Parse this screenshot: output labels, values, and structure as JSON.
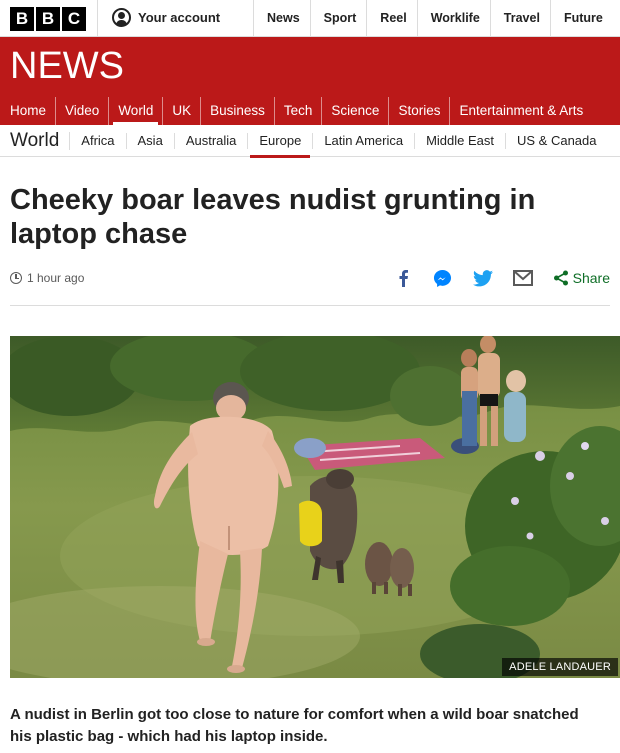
{
  "bbc_logo": [
    "B",
    "B",
    "C"
  ],
  "account": {
    "label": "Your account",
    "icon": "user-icon"
  },
  "top_nav": [
    "News",
    "Sport",
    "Reel",
    "Worklife",
    "Travel",
    "Future"
  ],
  "brand": {
    "section": "NEWS",
    "color": "#bb1919"
  },
  "main_nav": {
    "items": [
      "Home",
      "Video",
      "World",
      "UK",
      "Business",
      "Tech",
      "Science",
      "Stories",
      "Entertainment & Arts"
    ],
    "active": "World"
  },
  "sub_nav": {
    "section": "World",
    "items": [
      "Africa",
      "Asia",
      "Australia",
      "Europe",
      "Latin America",
      "Middle East",
      "US & Canada"
    ],
    "active": "Europe"
  },
  "article": {
    "headline": "Cheeky boar leaves nudist grunting in laptop chase",
    "timestamp": "1 hour ago",
    "share_label": "Share",
    "share_icons": [
      "facebook-icon",
      "messenger-icon",
      "twitter-icon",
      "email-icon",
      "share-icon"
    ],
    "image_credit": "ADELE LANDAUER",
    "summary": "A nudist in Berlin got too close to nature for comfort when a wild boar snatched his plastic bag - which had his laptop inside."
  }
}
